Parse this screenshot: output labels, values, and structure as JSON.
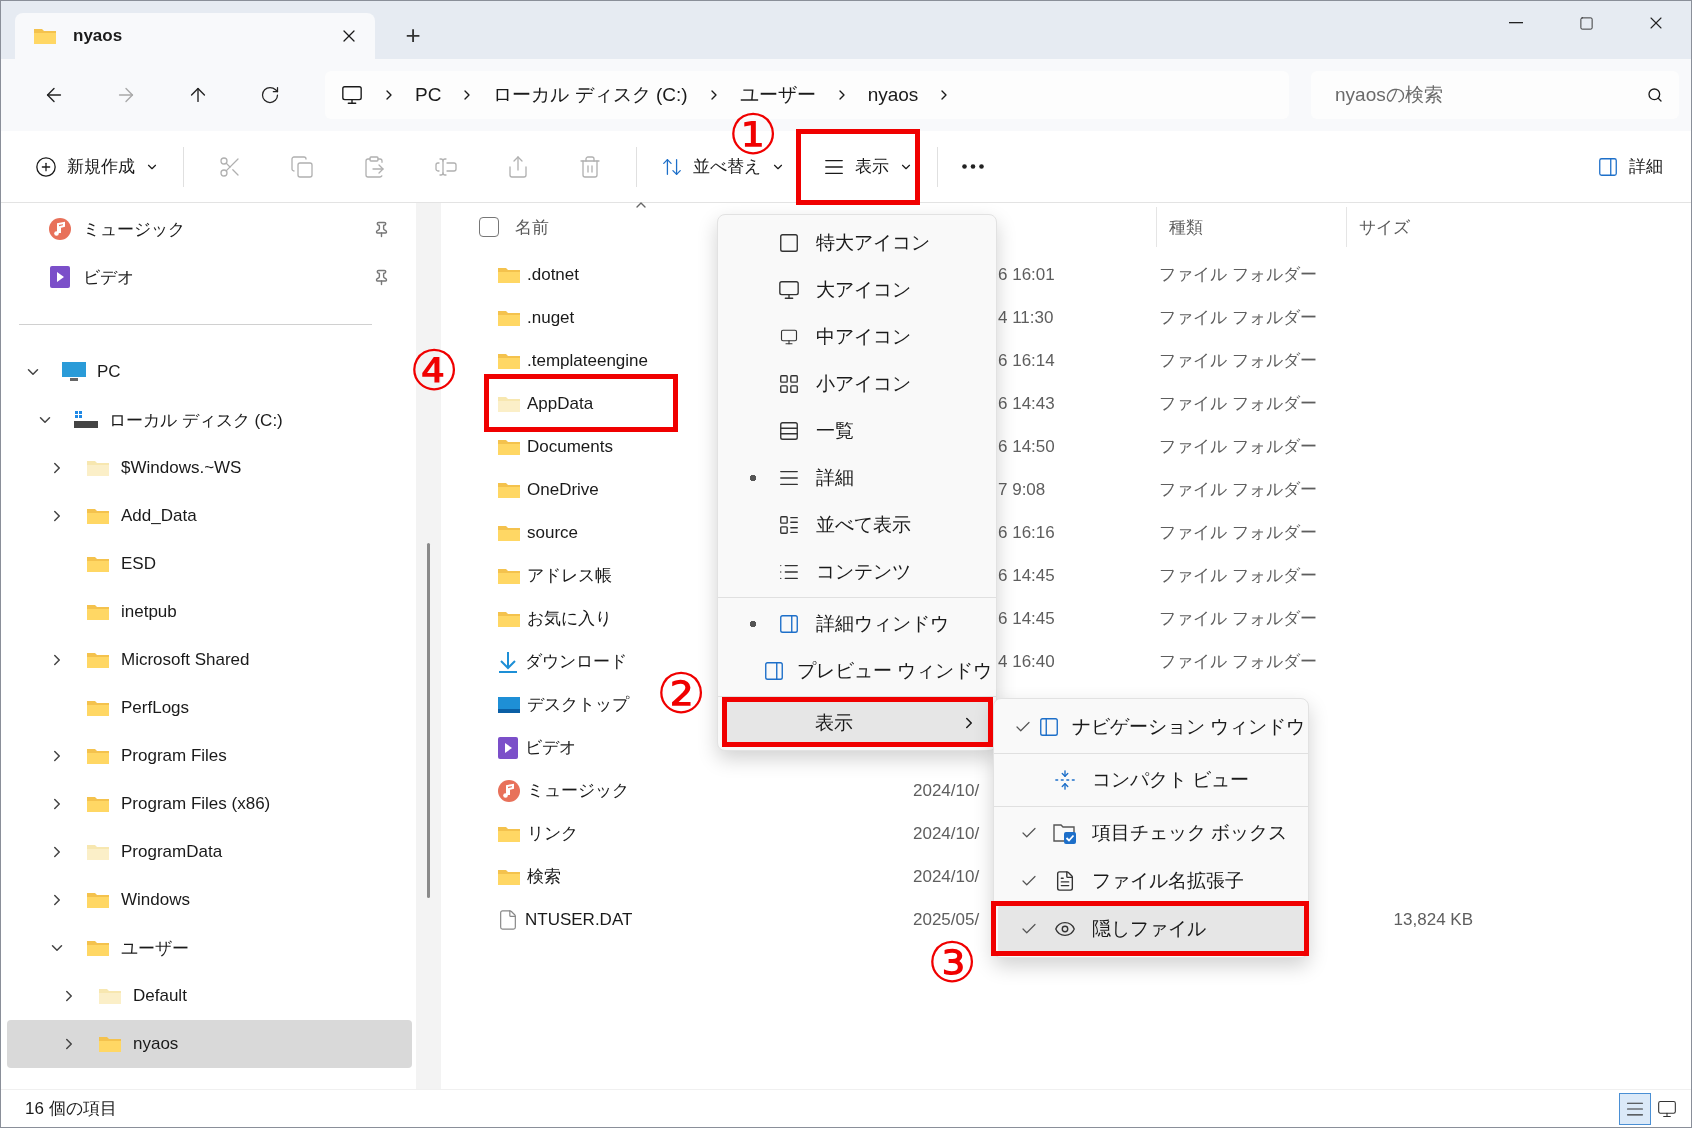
{
  "tabs": [
    {
      "title": "nyaos",
      "selected": true
    }
  ],
  "new_tab_button": "+",
  "address_bar": {
    "segments": [
      "PC",
      "ローカル ディスク (C:)",
      "ユーザー",
      "nyaos"
    ]
  },
  "search": {
    "placeholder": "nyaosの検索"
  },
  "toolbar": {
    "new_label": "新規作成",
    "sort_label": "並べ替え",
    "view_label": "表示",
    "details_label": "詳細"
  },
  "sidebar": {
    "quick_access": [
      {
        "label": "ミュージック",
        "kind": "music"
      },
      {
        "label": "ビデオ",
        "kind": "video"
      }
    ],
    "tree": [
      {
        "label": "PC",
        "kind": "pc",
        "expandable": true,
        "expanded": true,
        "selected": false,
        "children": [
          {
            "label": "ローカル ディスク (C:)",
            "kind": "drive",
            "expandable": true,
            "expanded": true,
            "selected": false,
            "children": [
              {
                "label": "$Windows.~WS",
                "kind": "folder",
                "hidden": true,
                "expandable": true,
                "expanded": false,
                "selected": false
              },
              {
                "label": "Add_Data",
                "kind": "folder",
                "hidden": false,
                "expandable": true,
                "expanded": false,
                "selected": false
              },
              {
                "label": "ESD",
                "kind": "folder",
                "hidden": false,
                "expandable": false,
                "selected": false
              },
              {
                "label": "inetpub",
                "kind": "folder",
                "hidden": false,
                "expandable": false,
                "selected": false
              },
              {
                "label": "Microsoft Shared",
                "kind": "folder",
                "hidden": false,
                "expandable": true,
                "expanded": false,
                "selected": false
              },
              {
                "label": "PerfLogs",
                "kind": "folder",
                "hidden": false,
                "expandable": false,
                "selected": false
              },
              {
                "label": "Program Files",
                "kind": "folder",
                "hidden": false,
                "expandable": true,
                "expanded": false,
                "selected": false
              },
              {
                "label": "Program Files (x86)",
                "kind": "folder",
                "hidden": false,
                "expandable": true,
                "expanded": false,
                "selected": false
              },
              {
                "label": "ProgramData",
                "kind": "folder",
                "hidden": true,
                "expandable": true,
                "expanded": false,
                "selected": false
              },
              {
                "label": "Windows",
                "kind": "folder",
                "hidden": false,
                "expandable": true,
                "expanded": false,
                "selected": false
              },
              {
                "label": "ユーザー",
                "kind": "folder",
                "hidden": false,
                "expandable": true,
                "expanded": true,
                "selected": false,
                "children": [
                  {
                    "label": "Default",
                    "kind": "folder",
                    "hidden": true,
                    "expandable": true,
                    "expanded": false,
                    "selected": false
                  },
                  {
                    "label": "nyaos",
                    "kind": "folder",
                    "hidden": false,
                    "expandable": true,
                    "expanded": false,
                    "selected": true
                  }
                ]
              }
            ]
          }
        ]
      }
    ]
  },
  "file_list": {
    "select_all": {
      "checked": false
    },
    "columns": [
      {
        "label": "名前"
      },
      {
        "label": "種類"
      },
      {
        "label": "サイズ"
      }
    ],
    "rows": [
      {
        "name": ".dotnet",
        "kind": "folder",
        "hidden": false,
        "modified": "6 16:01",
        "type": "ファイル フォルダー"
      },
      {
        "name": ".nuget",
        "kind": "folder",
        "hidden": false,
        "modified": "4 11:30",
        "type": "ファイル フォルダー"
      },
      {
        "name": ".templateengine",
        "kind": "folder",
        "hidden": false,
        "modified": "6 16:14",
        "type": "ファイル フォルダー"
      },
      {
        "name": "AppData",
        "kind": "folder",
        "hidden": true,
        "modified": "6 14:43",
        "type": "ファイル フォルダー"
      },
      {
        "name": "Documents",
        "kind": "folder",
        "hidden": false,
        "modified": "6 14:50",
        "type": "ファイル フォルダー"
      },
      {
        "name": "OneDrive",
        "kind": "folder",
        "hidden": false,
        "modified": "7 9:08",
        "type": "ファイル フォルダー"
      },
      {
        "name": "source",
        "kind": "folder",
        "hidden": false,
        "modified": "6 16:16",
        "type": "ファイル フォルダー"
      },
      {
        "name": "アドレス帳",
        "kind": "folder",
        "hidden": false,
        "modified": "6 14:45",
        "type": "ファイル フォルダー"
      },
      {
        "name": "お気に入り",
        "kind": "folder",
        "hidden": false,
        "modified": "6 14:45",
        "type": "ファイル フォルダー"
      },
      {
        "name": "ダウンロード",
        "kind": "download",
        "modified": "4 16:40",
        "type": "ファイル フォルダー"
      },
      {
        "name": "デスクトップ",
        "kind": "desktop"
      },
      {
        "name": "ビデオ",
        "kind": "video"
      },
      {
        "name": "ミュージック",
        "kind": "music",
        "modified": "2024/10/"
      },
      {
        "name": "リンク",
        "kind": "folder",
        "hidden": false,
        "modified": "2024/10/"
      },
      {
        "name": "検索",
        "kind": "folder",
        "hidden": false,
        "modified": "2024/10/"
      },
      {
        "name": "NTUSER.DAT",
        "kind": "file",
        "modified": "2025/05/",
        "size": "13,824 KB"
      }
    ]
  },
  "view_menu": {
    "groups": [
      [
        {
          "label": "特大アイコン",
          "kind": "option",
          "selected": false,
          "highlighted": false
        },
        {
          "label": "大アイコン",
          "kind": "option",
          "selected": false,
          "highlighted": false
        },
        {
          "label": "中アイコン",
          "kind": "option",
          "selected": false,
          "highlighted": false
        },
        {
          "label": "小アイコン",
          "kind": "option",
          "selected": false,
          "highlighted": false
        },
        {
          "label": "一覧",
          "kind": "option",
          "selected": false,
          "highlighted": false
        },
        {
          "label": "詳細",
          "kind": "option",
          "selected": true,
          "highlighted": false
        },
        {
          "label": "並べて表示",
          "kind": "option",
          "selected": false,
          "highlighted": false
        },
        {
          "label": "コンテンツ",
          "kind": "option",
          "selected": false,
          "highlighted": false
        }
      ],
      [
        {
          "label": "詳細ウィンドウ",
          "kind": "option",
          "selected": true,
          "highlighted": false
        },
        {
          "label": "プレビュー ウィンドウ",
          "kind": "option",
          "selected": false,
          "highlighted": false
        }
      ],
      [
        {
          "label": "表示",
          "kind": "submenu",
          "highlighted": true
        }
      ]
    ]
  },
  "show_submenu": {
    "groups": [
      [
        {
          "label": "ナビゲーション ウィンドウ",
          "checked": true,
          "highlighted": false
        }
      ],
      [
        {
          "label": "コンパクト ビュー",
          "checked": false,
          "highlighted": false
        }
      ],
      [
        {
          "label": "項目チェック ボックス",
          "checked": true,
          "highlighted": false
        },
        {
          "label": "ファイル名拡張子",
          "checked": true,
          "highlighted": false
        },
        {
          "label": "隠しファイル",
          "checked": true,
          "highlighted": true
        }
      ]
    ]
  },
  "status_bar": {
    "item_count": "16 個の項目",
    "view_buttons": [
      {
        "kind": "details",
        "selected": true
      },
      {
        "kind": "large_icons",
        "selected": false
      }
    ]
  },
  "annotations": [
    {
      "label": "①"
    },
    {
      "label": "②"
    },
    {
      "label": "③"
    },
    {
      "label": "④"
    }
  ]
}
